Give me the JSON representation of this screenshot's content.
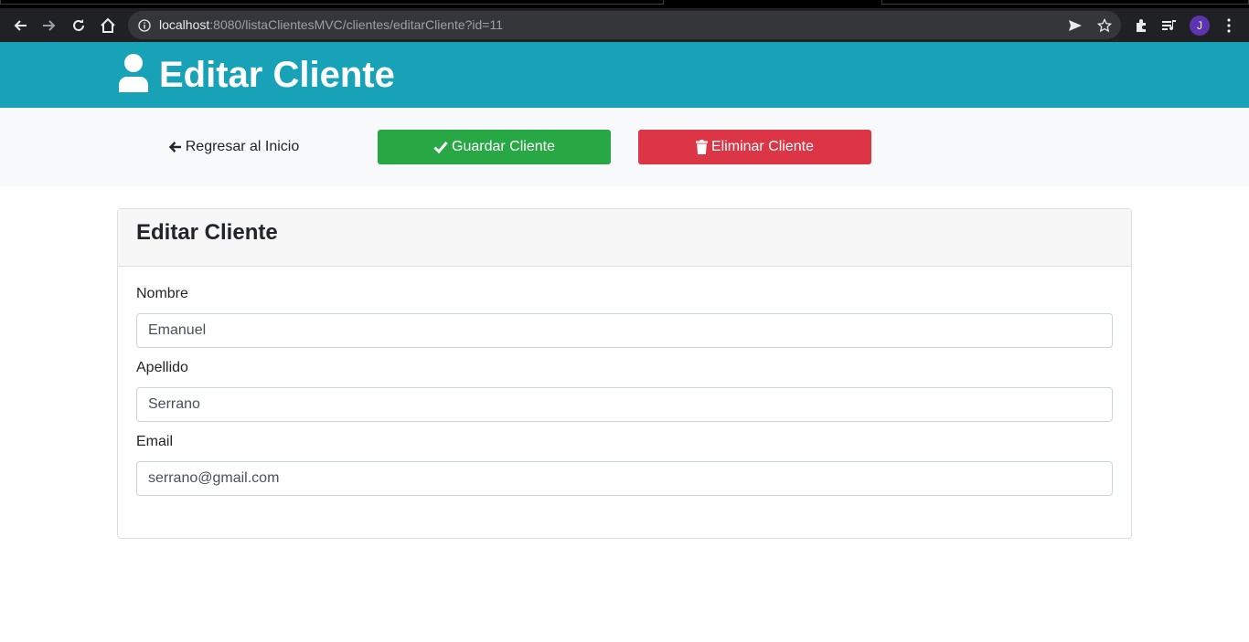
{
  "browser": {
    "url_host": "localhost",
    "url_rest": ":8080/listaClientesMVC/clientes/editarCliente?id=11",
    "profile_initial": "J"
  },
  "header": {
    "title": "Editar Cliente",
    "icon": "user-icon",
    "background": "#17a2b8"
  },
  "actions": {
    "back_label": "Regresar al Inicio",
    "save_label": "Guardar Cliente",
    "delete_label": "Eliminar Cliente",
    "save_color": "#28a745",
    "delete_color": "#dc3545"
  },
  "form": {
    "title": "Editar Cliente",
    "fields": [
      {
        "label": "Nombre",
        "value": "Emanuel"
      },
      {
        "label": "Apellido",
        "value": "Serrano"
      },
      {
        "label": "Email",
        "value": "serrano@gmail.com"
      }
    ]
  }
}
